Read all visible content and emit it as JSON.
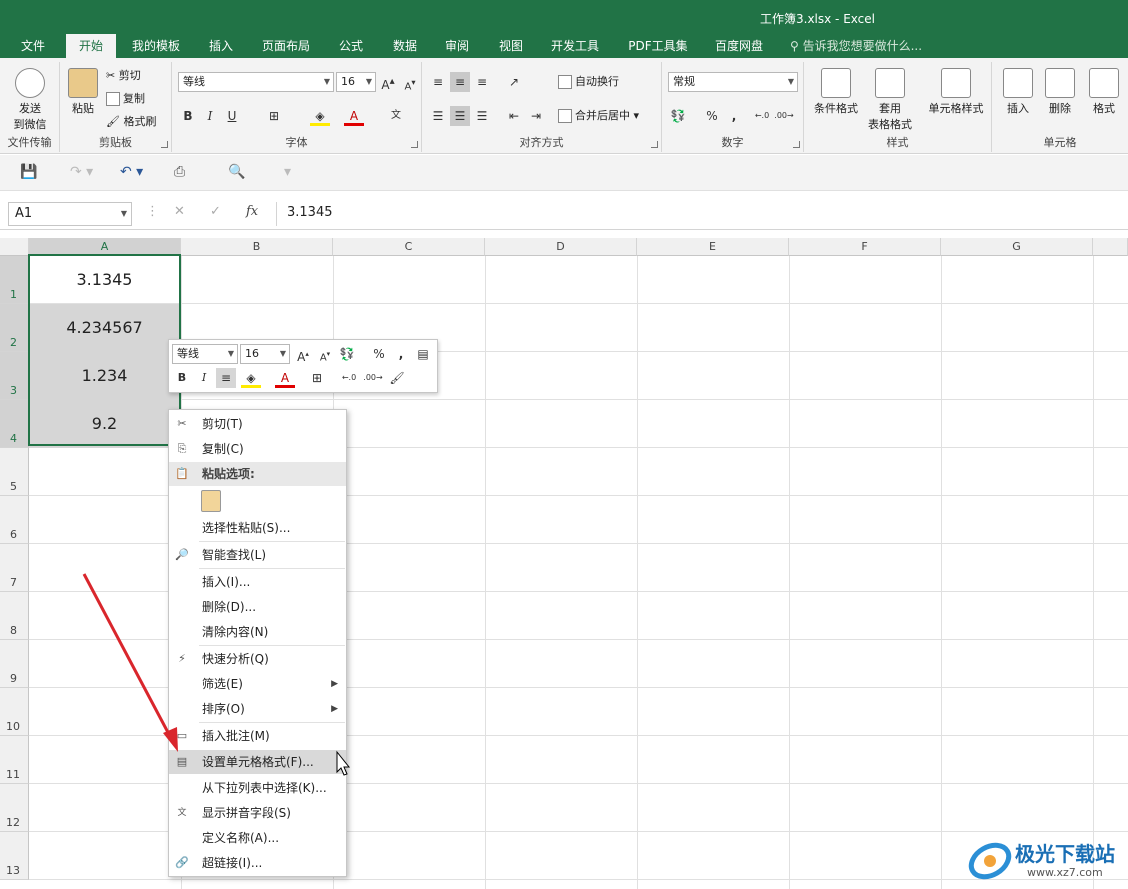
{
  "window": {
    "title": "工作簿3.xlsx - Excel"
  },
  "tabs": [
    "文件",
    "开始",
    "我的模板",
    "插入",
    "页面布局",
    "公式",
    "数据",
    "审阅",
    "视图",
    "开发工具",
    "PDF工具集",
    "百度网盘"
  ],
  "tell_me": "告诉我您想要做什么...",
  "ribbon": {
    "wechat": {
      "label1": "发送",
      "label2": "到微信",
      "group": "文件传输"
    },
    "clipboard": {
      "paste": "粘贴",
      "cut": "剪切",
      "copy": "复制",
      "format_painter": "格式刷",
      "group": "剪贴板"
    },
    "font": {
      "name": "等线",
      "size": "16",
      "group": "字体",
      "bold": "B",
      "italic": "I",
      "underline": "U",
      "grow": "A",
      "shrink": "A"
    },
    "alignment": {
      "wrap": "自动换行",
      "merge": "合并后居中",
      "group": "对齐方式"
    },
    "number": {
      "format": "常规",
      "percent": "%",
      "comma": ",",
      "group": "数字"
    },
    "styles": {
      "conditional": "条件格式",
      "table1": "套用",
      "table2": "表格格式",
      "cell_styles": "单元格样式",
      "group": "样式"
    },
    "cells": {
      "insert": "插入",
      "delete": "删除",
      "format": "格式",
      "group": "单元格"
    }
  },
  "formula_bar": {
    "name_box": "A1",
    "fx": "fx",
    "value": "3.1345"
  },
  "columns": [
    "A",
    "B",
    "C",
    "D",
    "E",
    "F",
    "G"
  ],
  "rows": [
    "1",
    "2",
    "3",
    "4",
    "5",
    "6",
    "7",
    "8",
    "9",
    "10",
    "11",
    "12",
    "13"
  ],
  "cells": {
    "a1": "3.1345",
    "a2": "4.234567",
    "a3": "1.234",
    "a4": "9.2"
  },
  "mini_toolbar": {
    "font": "等线",
    "size": "16",
    "percent": "%",
    "comma": ","
  },
  "context_menu": {
    "cut": "剪切(T)",
    "copy": "复制(C)",
    "paste_options": "粘贴选项:",
    "paste_special": "选择性粘贴(S)...",
    "smart_lookup": "智能查找(L)",
    "insert": "插入(I)...",
    "delete": "删除(D)...",
    "clear": "清除内容(N)",
    "quick_analysis": "快速分析(Q)",
    "filter": "筛选(E)",
    "sort": "排序(O)",
    "insert_comment": "插入批注(M)",
    "format_cells": "设置单元格格式(F)...",
    "pick_list": "从下拉列表中选择(K)...",
    "phonetic": "显示拼音字段(S)",
    "define_name": "定义名称(A)...",
    "hyperlink": "超链接(I)..."
  },
  "watermark": {
    "name": "极光下载站",
    "url": "www.xz7.com"
  },
  "colors": {
    "excel_green": "#217346",
    "annotation_arrow": "#d9262c"
  }
}
